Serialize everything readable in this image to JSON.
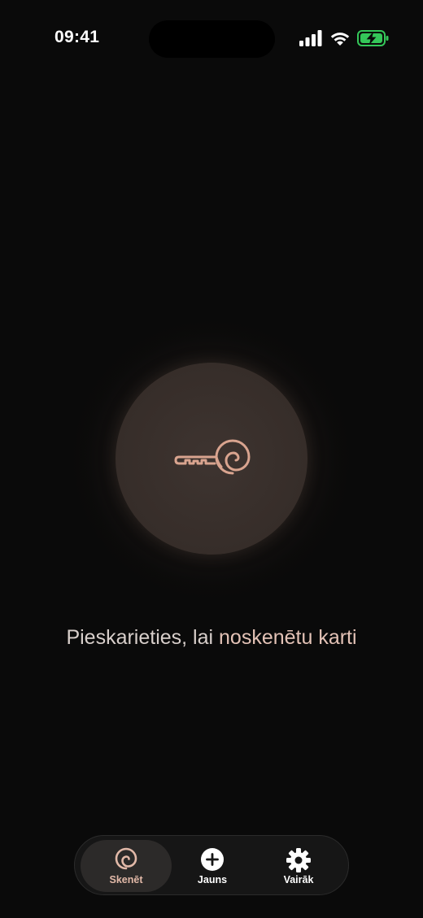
{
  "status_bar": {
    "time": "09:41",
    "icons": [
      "cellular-signal-icon",
      "wifi-icon",
      "battery-charging-icon"
    ],
    "battery_color": "#34c759"
  },
  "scan": {
    "icon": "spiral-key-icon",
    "prompt_main": "Pieskarieties, lai ",
    "prompt_accent": "noskenētu karti",
    "accent_color": "#d9a48f"
  },
  "tab_bar": {
    "tabs": [
      {
        "label": "Skenēt",
        "icon": "spiral-icon",
        "active": true
      },
      {
        "label": "Jauns",
        "icon": "plus-circle-icon",
        "active": false
      },
      {
        "label": "Vairāk",
        "icon": "gear-icon",
        "active": false
      }
    ]
  }
}
